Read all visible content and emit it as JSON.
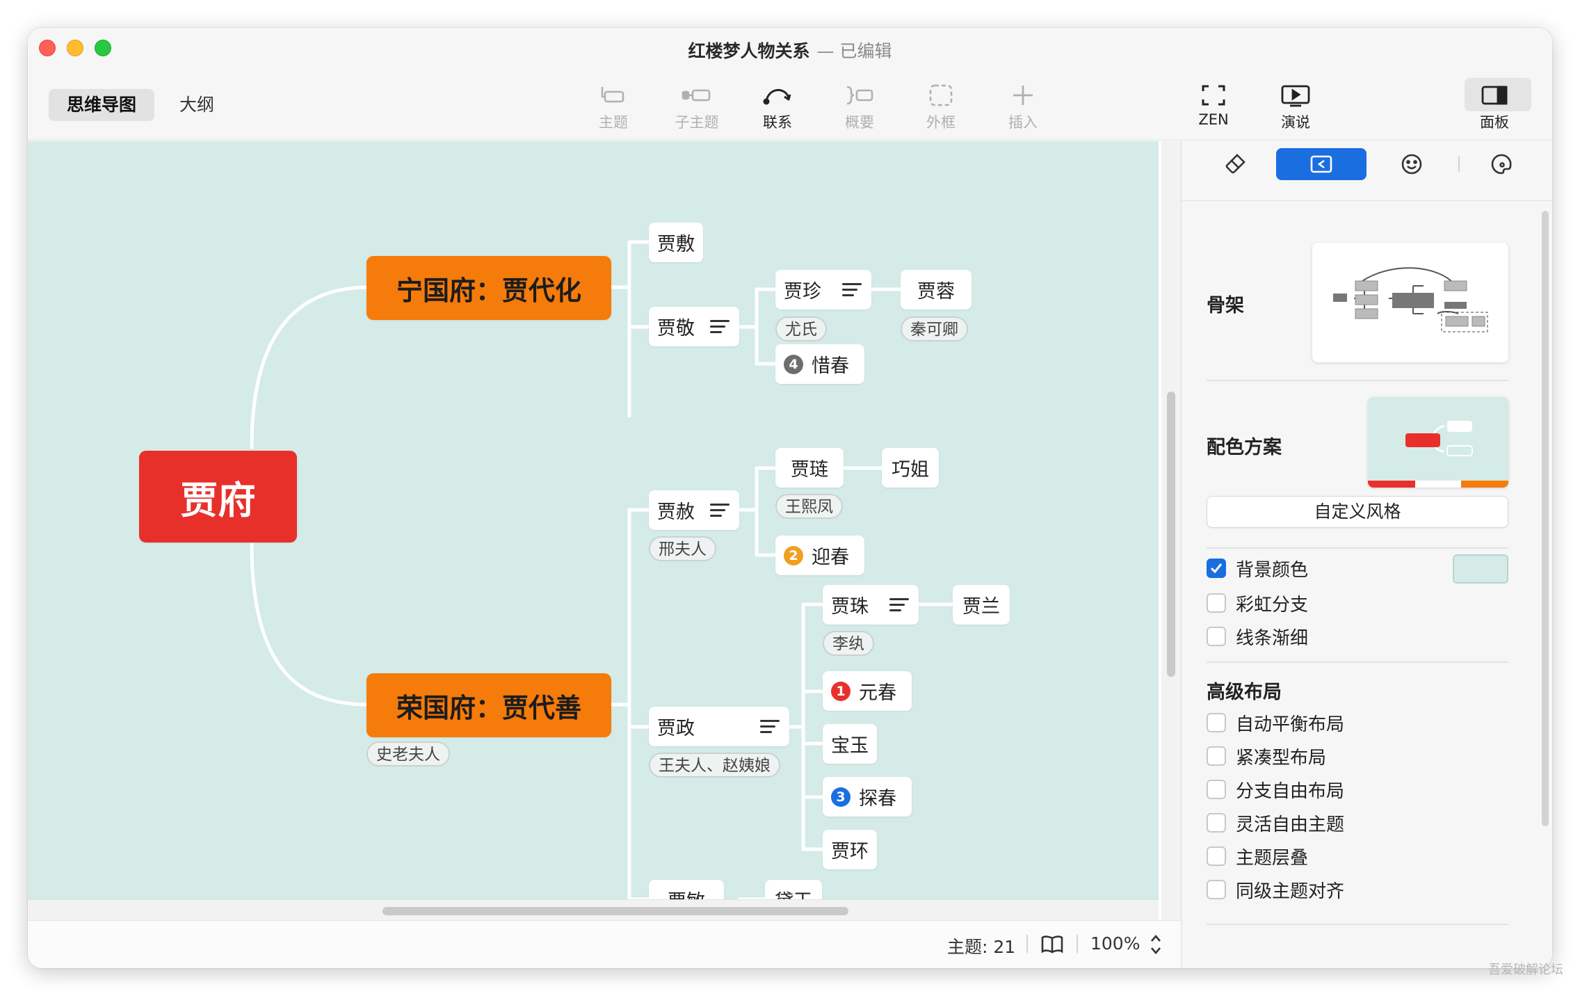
{
  "window": {
    "title": "红楼梦人物关系",
    "status": "— 已编辑"
  },
  "view_tabs": [
    {
      "label": "思维导图",
      "active": true
    },
    {
      "label": "大纲",
      "active": false
    }
  ],
  "toolbar": [
    {
      "label": "主题",
      "icon": "topic-icon"
    },
    {
      "label": "子主题",
      "icon": "subtopic-icon"
    },
    {
      "label": "联系",
      "icon": "relationship-icon"
    },
    {
      "label": "概要",
      "icon": "summary-icon"
    },
    {
      "label": "外框",
      "icon": "boundary-icon"
    },
    {
      "label": "插入",
      "icon": "plus-icon"
    },
    {
      "label": "ZEN",
      "icon": "fullscreen-icon"
    },
    {
      "label": "演说",
      "icon": "play-icon"
    },
    {
      "label": "面板",
      "icon": "sidebar-icon"
    }
  ],
  "mindmap": {
    "root": "贾府",
    "branches": {
      "ningguo": {
        "title": "宁国府：贾代化"
      },
      "rongguo": {
        "title": "荣国府：贾代善",
        "label": "史老夫人"
      }
    },
    "topics": {
      "jiafu": "贾敷",
      "jiajing": "贾敬",
      "jiazhen": "贾珍",
      "youshi": "尤氏",
      "jiarong": "贾蓉",
      "qinkeqing": "秦可卿",
      "xichun": "惜春",
      "jiashe": "贾赦",
      "xingfuren": "邢夫人",
      "jialian": "贾琏",
      "wangxifeng": "王熙凤",
      "qiaojie": "巧姐",
      "yingchun": "迎春",
      "jiazhu": "贾珠",
      "liwan": "李纨",
      "jialan": "贾兰",
      "yuanchun": "元春",
      "baoyu": "宝玉",
      "tanchun": "探春",
      "jiahuan": "贾环",
      "jiazheng": "贾政",
      "wangfuren": "王夫人、赵姨娘",
      "jiamin": "贾敏",
      "daiyu": "黛玉"
    },
    "badges": {
      "xichun": "4",
      "yingchun": "2",
      "yuanchun": "1",
      "tanchun": "3"
    },
    "colors": {
      "background": "#d4ebe8",
      "root": "#e8302b",
      "main": "#f57b0b",
      "line": "#ffffff"
    }
  },
  "statusbar": {
    "topic_count": "主题: 21",
    "zoom": "100%"
  },
  "panel": {
    "skeleton_label": "骨架",
    "color_theme_label": "配色方案",
    "custom_style": "自定义风格",
    "checks": [
      {
        "label": "背景颜色",
        "checked": true
      },
      {
        "label": "彩虹分支",
        "checked": false
      },
      {
        "label": "线条渐细",
        "checked": false
      }
    ],
    "advanced_title": "高级布局",
    "advanced": [
      {
        "label": "自动平衡布局",
        "checked": false
      },
      {
        "label": "紧凑型布局",
        "checked": false
      },
      {
        "label": "分支自由布局",
        "checked": false
      },
      {
        "label": "灵活自由主题",
        "checked": false
      },
      {
        "label": "主题层叠",
        "checked": false
      },
      {
        "label": "同级主题对齐",
        "checked": false
      }
    ],
    "accent": "#1a6ee0"
  },
  "watermark": "吾爱破解论坛"
}
